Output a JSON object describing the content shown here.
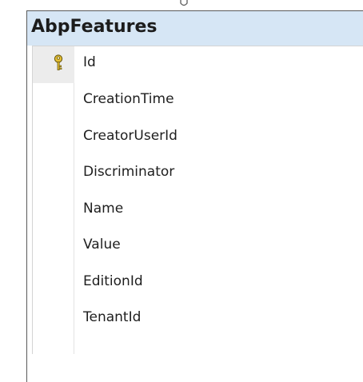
{
  "table": {
    "title": "AbpFeatures",
    "columns": [
      {
        "name": "Id",
        "primary_key": true
      },
      {
        "name": "CreationTime",
        "primary_key": false
      },
      {
        "name": "CreatorUserId",
        "primary_key": false
      },
      {
        "name": "Discriminator",
        "primary_key": false
      },
      {
        "name": "Name",
        "primary_key": false
      },
      {
        "name": "Value",
        "primary_key": false
      },
      {
        "name": "EditionId",
        "primary_key": false
      },
      {
        "name": "TenantId",
        "primary_key": false
      }
    ]
  },
  "colors": {
    "title_bar": "#d6e6f5",
    "border": "#5a5a5a",
    "key_icon": "#e8c233"
  },
  "icons": {
    "primary_key": "key-icon",
    "relationship": "relationship-connector-icon"
  }
}
